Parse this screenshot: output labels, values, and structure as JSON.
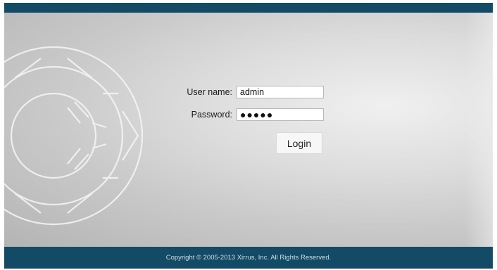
{
  "login": {
    "username_label": "User name:",
    "username_value": "admin",
    "password_label": "Password:",
    "password_value": "●●●●●",
    "login_button": "Login"
  },
  "footer": {
    "copyright": "Copyright © 2005-2013 Xirrus, Inc. All Rights Reserved."
  },
  "theme": {
    "bar_color": "#134b66",
    "background_gradient": [
      "#f0f0f0",
      "#b4b4b4"
    ]
  },
  "icons": {
    "watermark": "xirrus-array-logo"
  }
}
